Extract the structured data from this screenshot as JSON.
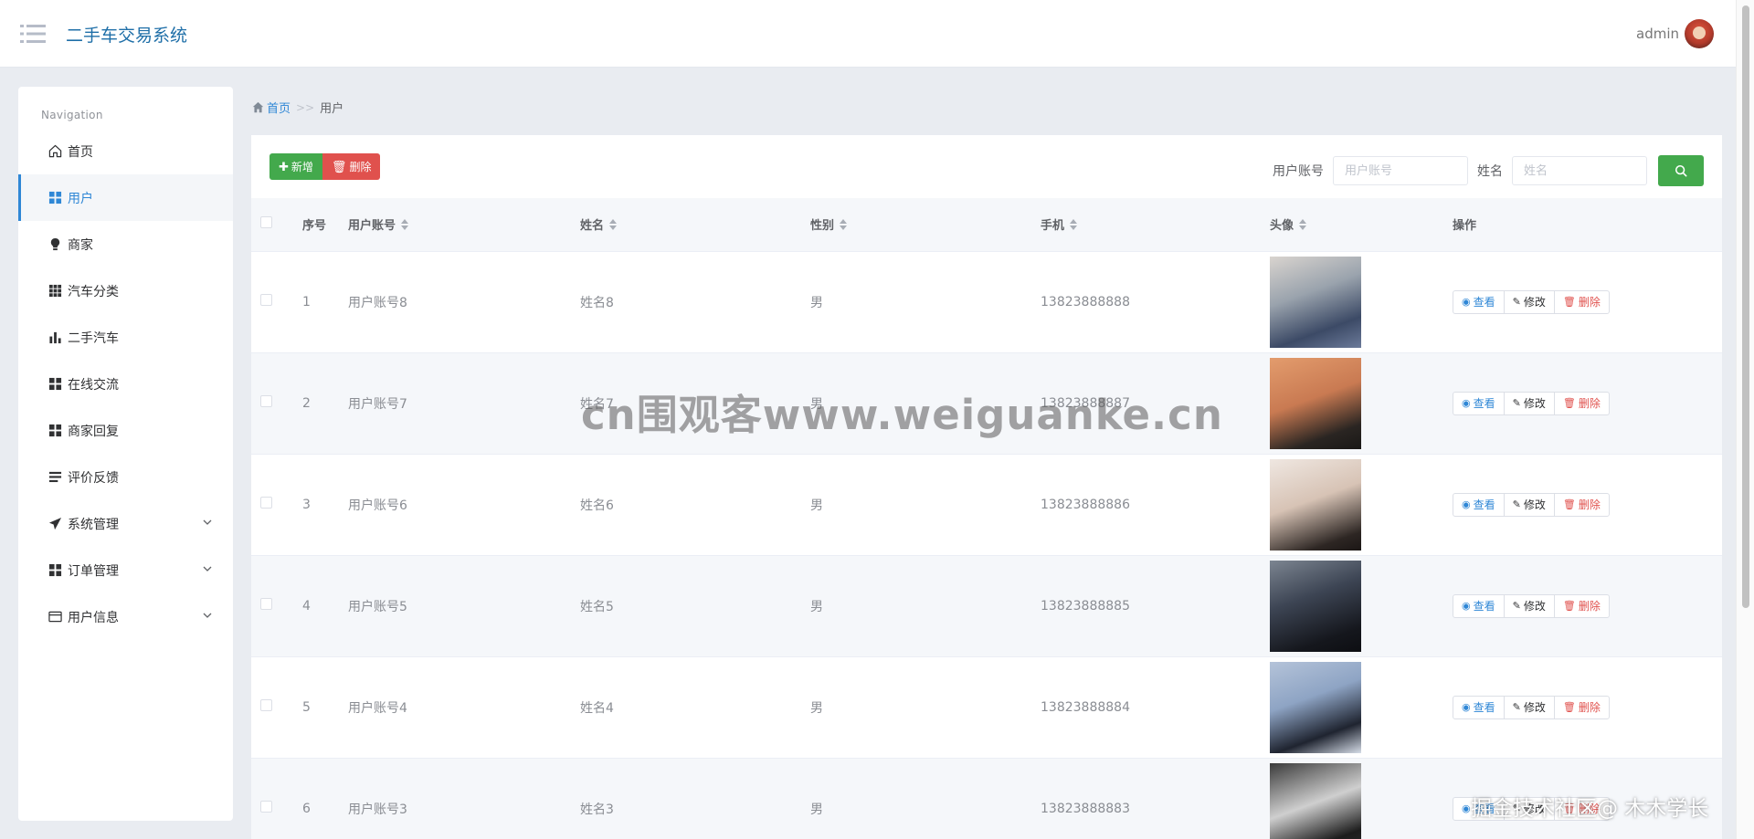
{
  "header": {
    "app_title": "二手车交易系统",
    "user_name": "admin"
  },
  "sidebar": {
    "heading": "Navigation",
    "items": [
      {
        "label": "首页",
        "icon": "home-icon",
        "active": false,
        "expandable": false
      },
      {
        "label": "用户",
        "icon": "grid-icon",
        "active": true,
        "expandable": false
      },
      {
        "label": "商家",
        "icon": "bulb-icon",
        "active": false,
        "expandable": false
      },
      {
        "label": "汽车分类",
        "icon": "apps-icon",
        "active": false,
        "expandable": false
      },
      {
        "label": "二手汽车",
        "icon": "bar-chart-icon",
        "active": false,
        "expandable": false
      },
      {
        "label": "在线交流",
        "icon": "grid-icon",
        "active": false,
        "expandable": false
      },
      {
        "label": "商家回复",
        "icon": "grid-icon",
        "active": false,
        "expandable": false
      },
      {
        "label": "评价反馈",
        "icon": "list-icon",
        "active": false,
        "expandable": false
      },
      {
        "label": "系统管理",
        "icon": "send-icon",
        "active": false,
        "expandable": true
      },
      {
        "label": "订单管理",
        "icon": "grid-icon",
        "active": false,
        "expandable": true
      },
      {
        "label": "用户信息",
        "icon": "card-icon",
        "active": false,
        "expandable": true
      }
    ]
  },
  "breadcrumb": {
    "home": "首页",
    "separator": ">>",
    "current": "用户"
  },
  "toolbar": {
    "add_label": "新增",
    "delete_label": "删除"
  },
  "search": {
    "account_label": "用户账号",
    "account_placeholder": "用户账号",
    "name_label": "姓名",
    "name_placeholder": "姓名"
  },
  "table": {
    "headers": {
      "index": "序号",
      "account": "用户账号",
      "name": "姓名",
      "sex": "性别",
      "phone": "手机",
      "avatar": "头像",
      "actions": "操作"
    },
    "action_labels": {
      "view": "查看",
      "edit": "修改",
      "delete": "删除"
    },
    "rows": [
      {
        "index": "1",
        "account": "用户账号8",
        "name": "姓名8",
        "sex": "男",
        "phone": "13823888888"
      },
      {
        "index": "2",
        "account": "用户账号7",
        "name": "姓名7",
        "sex": "男",
        "phone": "13823888887"
      },
      {
        "index": "3",
        "account": "用户账号6",
        "name": "姓名6",
        "sex": "男",
        "phone": "13823888886"
      },
      {
        "index": "4",
        "account": "用户账号5",
        "name": "姓名5",
        "sex": "男",
        "phone": "13823888885"
      },
      {
        "index": "5",
        "account": "用户账号4",
        "name": "姓名4",
        "sex": "男",
        "phone": "13823888884"
      },
      {
        "index": "6",
        "account": "用户账号3",
        "name": "姓名3",
        "sex": "男",
        "phone": "13823888883"
      }
    ]
  },
  "watermarks": {
    "center": "cn围观客www.weiguanke.cn",
    "corner": "掘金技术社区@ 木木学长"
  },
  "colors": {
    "brand_blue": "#2f87d6",
    "add_green": "#43a94c",
    "delete_red": "#e0514d",
    "title_blue": "#1f6fa8"
  }
}
